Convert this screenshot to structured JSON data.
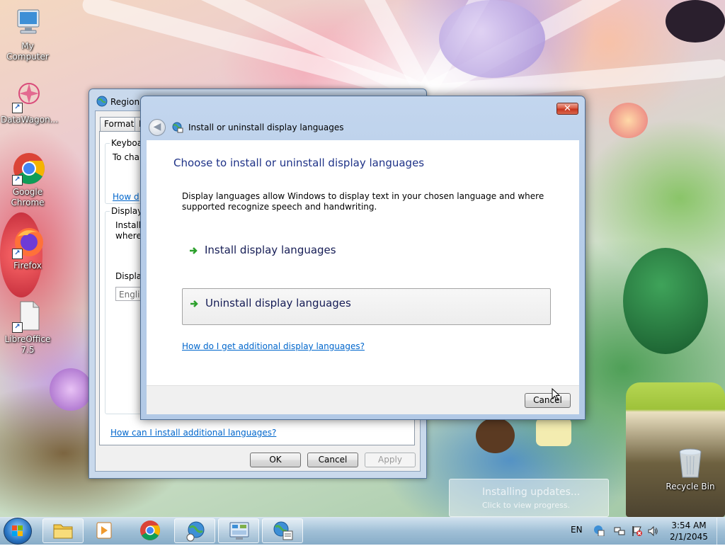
{
  "desktop": {
    "icons": [
      {
        "label": "My Computer"
      },
      {
        "label": "DataWagon..."
      },
      {
        "label": "Google Chrome"
      },
      {
        "label": "Firefox"
      },
      {
        "label": "LibreOffice 7.5"
      },
      {
        "label": "Recycle Bin"
      }
    ]
  },
  "region_window": {
    "title": "Region a",
    "tabs": [
      "Formats",
      "L"
    ],
    "keyboards_group": {
      "title": "Keyboa",
      "text": "To cha",
      "link": "How d"
    },
    "display_group": {
      "title": "Display",
      "text_line1": "Install",
      "text_line2": "where",
      "lang_label": "Displa",
      "lang_value": "Engli"
    },
    "bottom_link": "How can I install additional languages?",
    "buttons": {
      "ok": "OK",
      "cancel": "Cancel",
      "apply": "Apply"
    }
  },
  "language_dialog": {
    "title": "Install or uninstall display languages",
    "heading": "Choose to install or uninstall display languages",
    "description": "Display languages allow Windows to display text in your chosen language and where supported recognize speech and handwriting.",
    "install_option": "Install display languages",
    "uninstall_option": "Uninstall display languages",
    "help_link": "How do I get additional display languages?",
    "cancel_button": "Cancel",
    "close_glyph": "✕",
    "back_glyph": "◀"
  },
  "notification": {
    "title": "Installing updates...",
    "subtitle": "Click to view progress."
  },
  "taskbar": {
    "language_indicator": "EN",
    "clock_time": "3:54 AM",
    "clock_date": "2/1/2045"
  },
  "colors": {
    "link": "#0066cc",
    "heading": "#1e3287",
    "arrow": "#2ca02c",
    "close_red": "#c5321c"
  }
}
